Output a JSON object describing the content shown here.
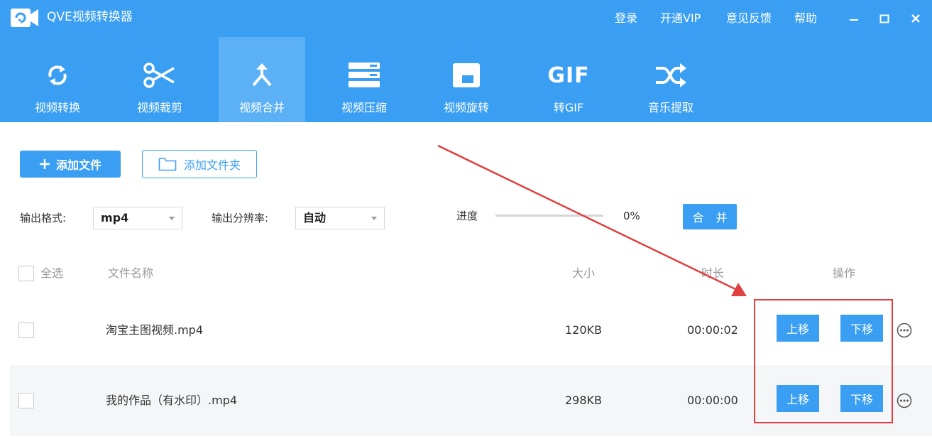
{
  "app": {
    "title": "QVE视频转换器",
    "menu": {
      "login": "登录",
      "vip": "开通VIP",
      "feedback": "意见反馈",
      "help": "帮助"
    },
    "colors": {
      "primary": "#3a9ff3",
      "active_tab": "#5cb1f6",
      "annotation": "#e04040"
    }
  },
  "tools": [
    {
      "label": "视频转换",
      "icon": "convert-icon"
    },
    {
      "label": "视频裁剪",
      "icon": "scissors-icon"
    },
    {
      "label": "视频合并",
      "icon": "merge-icon",
      "active": true
    },
    {
      "label": "视频压缩",
      "icon": "compress-icon"
    },
    {
      "label": "视频旋转",
      "icon": "rotate-icon"
    },
    {
      "label": "转GIF",
      "icon": "gif-icon",
      "icon_text": "GIF"
    },
    {
      "label": "音乐提取",
      "icon": "shuffle-icon"
    }
  ],
  "toolbar": {
    "add_file": "添加文件",
    "add_folder": "添加文件夹"
  },
  "options": {
    "format_label": "输出格式:",
    "format_value": "mp4",
    "resolution_label": "输出分辨率:",
    "resolution_value": "自动",
    "progress_label": "进度",
    "progress_value": 0,
    "progress_text": "0%",
    "merge_button": "合 并"
  },
  "table": {
    "headers": {
      "select_all": "全选",
      "name": "文件名称",
      "size": "大小",
      "duration": "时长",
      "actions": "操作"
    },
    "rows": [
      {
        "name": "淘宝主图视频.mp4",
        "size": "120KB",
        "duration": "00:00:02",
        "up": "上移",
        "down": "下移"
      },
      {
        "name": "我的作品（有水印）.mp4",
        "size": "298KB",
        "duration": "00:00:00",
        "up": "上移",
        "down": "下移"
      }
    ]
  }
}
